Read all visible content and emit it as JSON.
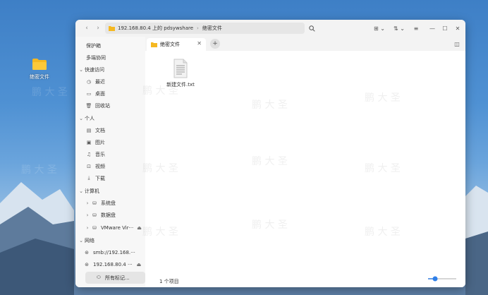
{
  "desktop": {
    "folder_label": "绝密文件"
  },
  "window": {
    "address": {
      "crumb1": "192.168.80.4 上的 pdsywshare",
      "crumb2": "绝密文件"
    },
    "sidebar": {
      "items": [
        {
          "label": "保护箱"
        },
        {
          "label": "多端协同"
        },
        {
          "label": "快速访问"
        },
        {
          "label": "最近"
        },
        {
          "label": "桌面"
        },
        {
          "label": "回收站"
        },
        {
          "label": "个人"
        },
        {
          "label": "文档"
        },
        {
          "label": "图片"
        },
        {
          "label": "音乐"
        },
        {
          "label": "视频"
        },
        {
          "label": "下载"
        },
        {
          "label": "计算机"
        },
        {
          "label": "系统盘"
        },
        {
          "label": "数据盘"
        },
        {
          "label": "VMware Vir···"
        },
        {
          "label": "网络"
        },
        {
          "label": "smb://192.168.···"
        },
        {
          "label": "192.168.80.4 ···"
        },
        {
          "label": "所有标记..."
        }
      ]
    },
    "tab": {
      "label": "绝密文件"
    },
    "file": {
      "name": "新建文件.txt"
    },
    "status": {
      "count": "1 个项目"
    },
    "zoom": {
      "level": 0.25
    }
  },
  "watermark_text": "鹏 大 圣"
}
